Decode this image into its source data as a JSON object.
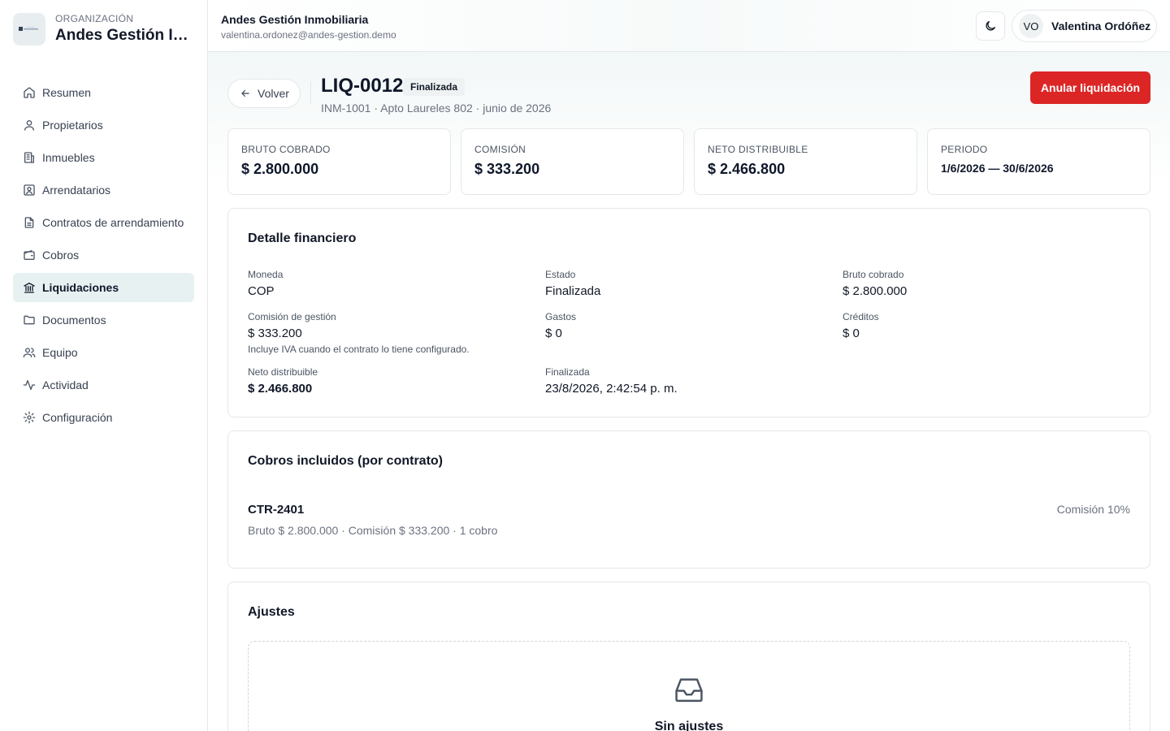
{
  "sidebar": {
    "org_caption": "ORGANIZACIÓN",
    "org_name": "Andes Gestión Inmobiliaria",
    "items": [
      {
        "label": "Resumen",
        "icon": "home-icon"
      },
      {
        "label": "Propietarios",
        "icon": "user-icon"
      },
      {
        "label": "Inmuebles",
        "icon": "building-icon"
      },
      {
        "label": "Arrendatarios",
        "icon": "contact-icon"
      },
      {
        "label": "Contratos de arrendamiento",
        "icon": "document-icon"
      },
      {
        "label": "Cobros",
        "icon": "wallet-icon"
      },
      {
        "label": "Liquidaciones",
        "icon": "bank-icon",
        "active": true
      },
      {
        "label": "Documentos",
        "icon": "folder-icon"
      },
      {
        "label": "Equipo",
        "icon": "users-icon"
      },
      {
        "label": "Actividad",
        "icon": "activity-icon"
      },
      {
        "label": "Configuración",
        "icon": "gear-icon"
      }
    ]
  },
  "header": {
    "title": "Andes Gestión Inmobiliaria",
    "email": "valentina.ordonez@andes-gestion.demo",
    "user_initials": "VO",
    "user_name": "Valentina Ordóñez"
  },
  "page": {
    "back_label": "Volver",
    "title": "LIQ-0012",
    "status": "Finalizada",
    "subtitle": "INM-1001 · Apto Laureles 802 · junio de 2026",
    "annul_label": "Anular liquidación"
  },
  "stats": [
    {
      "label": "BRUTO COBRADO",
      "value": "$ 2.800.000"
    },
    {
      "label": "COMISIÓN",
      "value": "$ 333.200"
    },
    {
      "label": "NETO DISTRIBUIBLE",
      "value": "$ 2.466.800"
    },
    {
      "label": "PERIODO",
      "value": "1/6/2026 — 30/6/2026"
    }
  ],
  "financial": {
    "title": "Detalle financiero",
    "moneda_label": "Moneda",
    "moneda": "COP",
    "estado_label": "Estado",
    "estado": "Finalizada",
    "bruto_label": "Bruto cobrado",
    "bruto": "$ 2.800.000",
    "comision_label": "Comisión de gestión",
    "comision": "$ 333.200",
    "comision_note": "Incluye IVA cuando el contrato lo tiene configurado.",
    "gastos_label": "Gastos",
    "gastos": "$ 0",
    "creditos_label": "Créditos",
    "creditos": "$ 0",
    "neto_label": "Neto distribuible",
    "neto": "$ 2.466.800",
    "finalizada_label": "Finalizada",
    "finalizada": "23/8/2026, 2:42:54 p. m."
  },
  "cobros": {
    "title": "Cobros incluidos (por contrato)",
    "contract_code": "CTR-2401",
    "contract_detail": "Bruto $ 2.800.000 · Comisión $ 333.200 · 1 cobro",
    "contract_commission": "Comisión 10%"
  },
  "ajustes": {
    "title": "Ajustes",
    "empty_text": "Sin ajustes"
  },
  "colors": {
    "accent_active_bg": "#e8f1f1",
    "danger": "#dc2626"
  }
}
